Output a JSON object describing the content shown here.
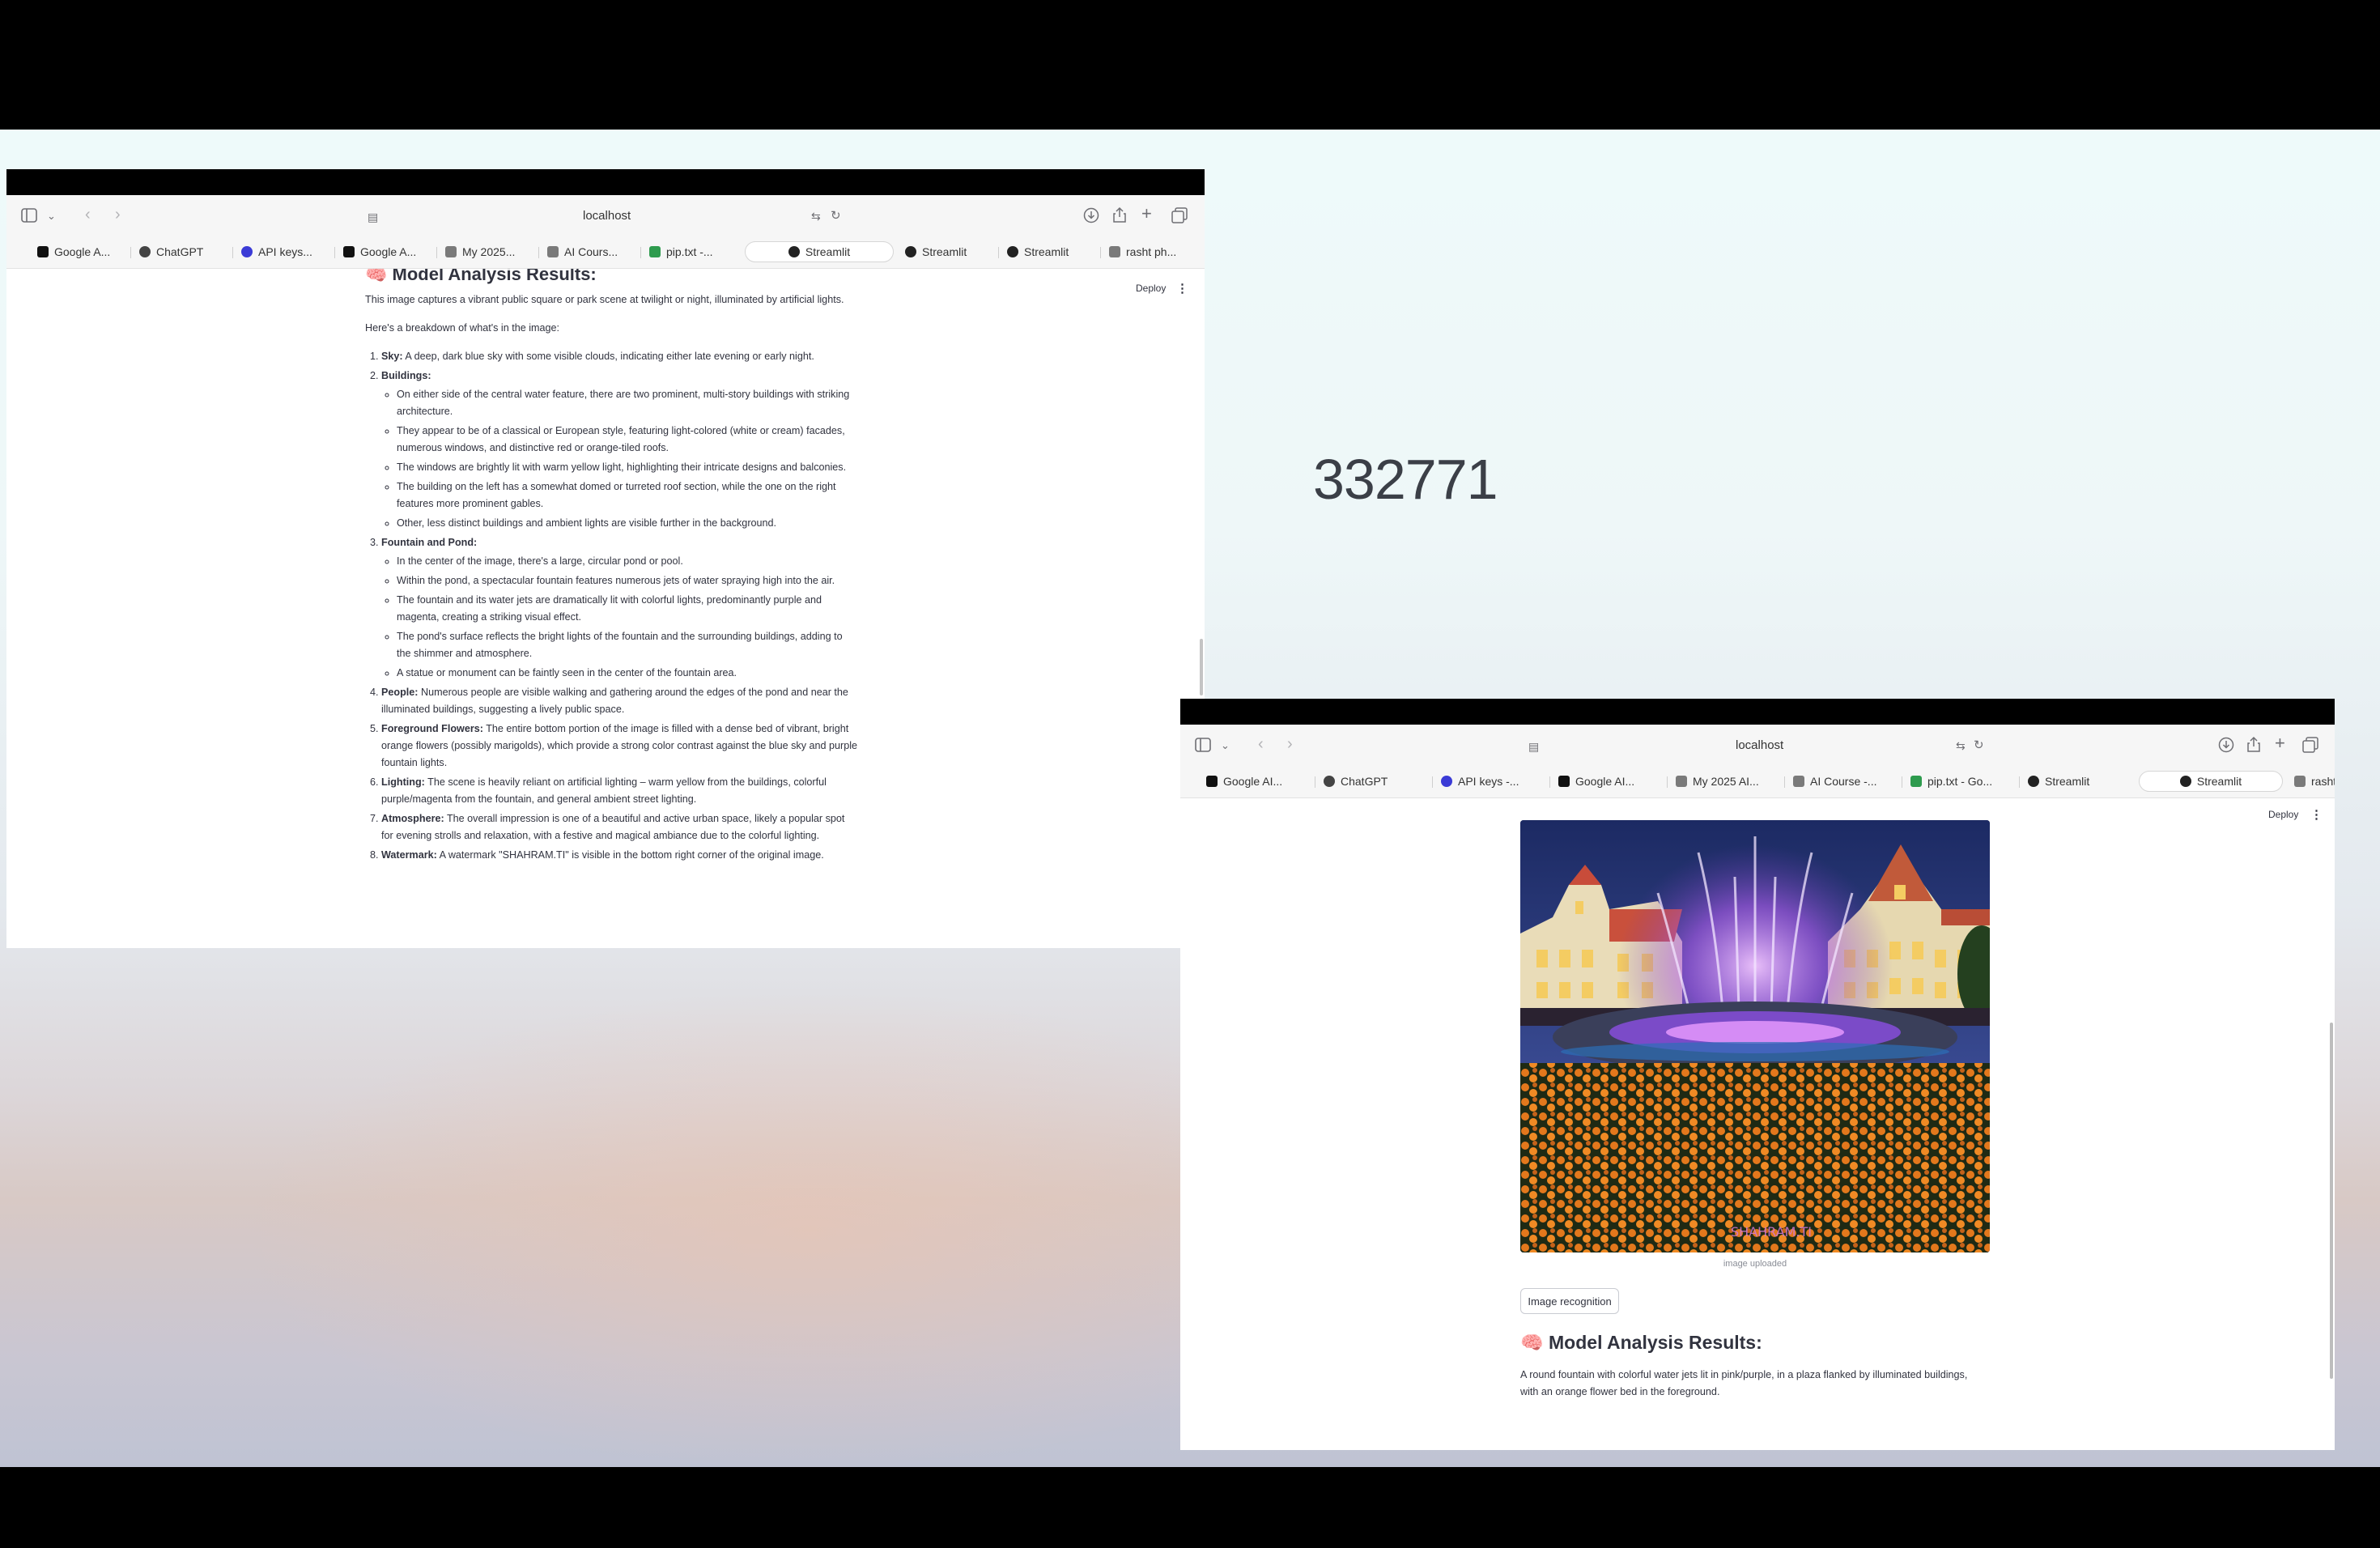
{
  "desktop": {
    "overlay_number": "332771"
  },
  "browser": {
    "url": "localhost",
    "tabs_left": [
      {
        "label": "Google A...",
        "icon": "google-ai-studio-icon",
        "color": "#111111"
      },
      {
        "label": "ChatGPT",
        "icon": "chatgpt-icon",
        "color": "#444444"
      },
      {
        "label": "API keys...",
        "icon": "api-keys-icon",
        "color": "#3b3bd6"
      },
      {
        "label": "Google A...",
        "icon": "google-ai-studio-icon",
        "color": "#111111"
      },
      {
        "label": "My 2025...",
        "icon": "doc-icon",
        "color": "#7a7a7a"
      },
      {
        "label": "AI Cours...",
        "icon": "doc-icon",
        "color": "#7a7a7a"
      },
      {
        "label": "pip.txt -...",
        "icon": "google-drive-icon",
        "color": "#2e9b4e"
      },
      {
        "label": "Streamlit",
        "icon": "streamlit-icon",
        "color": "#222222"
      },
      {
        "label": "Streamlit",
        "icon": "streamlit-icon",
        "color": "#222222"
      },
      {
        "label": "Streamlit",
        "icon": "streamlit-icon",
        "color": "#222222"
      },
      {
        "label": "rasht ph...",
        "icon": "image-icon",
        "color": "#7a7a7a"
      }
    ],
    "tabs_right": [
      {
        "label": "Google AI...",
        "icon": "google-ai-studio-icon",
        "color": "#111111"
      },
      {
        "label": "ChatGPT",
        "icon": "chatgpt-icon",
        "color": "#444444"
      },
      {
        "label": "API keys -...",
        "icon": "api-keys-icon",
        "color": "#3b3bd6"
      },
      {
        "label": "Google AI...",
        "icon": "google-ai-studio-icon",
        "color": "#111111"
      },
      {
        "label": "My 2025 AI...",
        "icon": "doc-icon",
        "color": "#7a7a7a"
      },
      {
        "label": "AI Course -...",
        "icon": "doc-icon",
        "color": "#7a7a7a"
      },
      {
        "label": "pip.txt - Go...",
        "icon": "google-drive-icon",
        "color": "#2e9b4e"
      },
      {
        "label": "Streamlit",
        "icon": "streamlit-icon",
        "color": "#222222"
      },
      {
        "label": "Streamlit",
        "icon": "streamlit-icon",
        "color": "#222222"
      },
      {
        "label": "rasht phot...",
        "icon": "image-icon",
        "color": "#7a7a7a"
      }
    ],
    "active_tab_left_index": 7,
    "active_tab_right_index": 8
  },
  "app": {
    "deploy_label": "Deploy",
    "menu_glyph": "⋮",
    "results_heading": "🧠 Model Analysis Results:",
    "intro": "This image captures a vibrant public square or park scene at twilight or night, illuminated by artificial lights.",
    "breakdown_intro": "Here's a breakdown of what's in the image:",
    "items": [
      {
        "label": "Sky:",
        "text": " A deep, dark blue sky with some visible clouds, indicating either late evening or early night.",
        "sub": []
      },
      {
        "label": "Buildings:",
        "text": "",
        "sub": [
          "On either side of the central water feature, there are two prominent, multi-story buildings with striking architecture.",
          "They appear to be of a classical or European style, featuring light-colored (white or cream) facades, numerous windows, and distinctive red or orange-tiled roofs.",
          "The windows are brightly lit with warm yellow light, highlighting their intricate designs and balconies.",
          "The building on the left has a somewhat domed or turreted roof section, while the one on the right features more prominent gables.",
          "Other, less distinct buildings and ambient lights are visible further in the background."
        ]
      },
      {
        "label": "Fountain and Pond:",
        "text": "",
        "sub": [
          "In the center of the image, there's a large, circular pond or pool.",
          "Within the pond, a spectacular fountain features numerous jets of water spraying high into the air.",
          "The fountain and its water jets are dramatically lit with colorful lights, predominantly purple and magenta, creating a striking visual effect.",
          "The pond's surface reflects the bright lights of the fountain and the surrounding buildings, adding to the shimmer and atmosphere.",
          "A statue or monument can be faintly seen in the center of the fountain area."
        ]
      },
      {
        "label": "People:",
        "text": " Numerous people are visible walking and gathering around the edges of the pond and near the illuminated buildings, suggesting a lively public space.",
        "sub": []
      },
      {
        "label": "Foreground Flowers:",
        "text": " The entire bottom portion of the image is filled with a dense bed of vibrant, bright orange flowers (possibly marigolds), which provide a strong color contrast against the blue sky and purple fountain lights.",
        "sub": []
      },
      {
        "label": "Lighting:",
        "text": " The scene is heavily reliant on artificial lighting – warm yellow from the buildings, colorful purple/magenta from the fountain, and general ambient street lighting.",
        "sub": []
      },
      {
        "label": "Atmosphere:",
        "text": " The overall impression is one of a beautiful and active urban space, likely a popular spot for evening strolls and relaxation, with a festive and magical ambiance due to the colorful lighting.",
        "sub": []
      },
      {
        "label": "Watermark:",
        "text": " A watermark \"SHAHRAM.TI\" is visible in the bottom right corner of the original image.",
        "sub": []
      }
    ],
    "image_caption": "image uploaded",
    "watermark_text": "SHAHRAM.TI",
    "recognize_button": "Image recognition",
    "short_result": "A round fountain with colorful water jets lit in pink/purple, in a plaza flanked by illuminated buildings, with an orange flower bed in the foreground."
  }
}
